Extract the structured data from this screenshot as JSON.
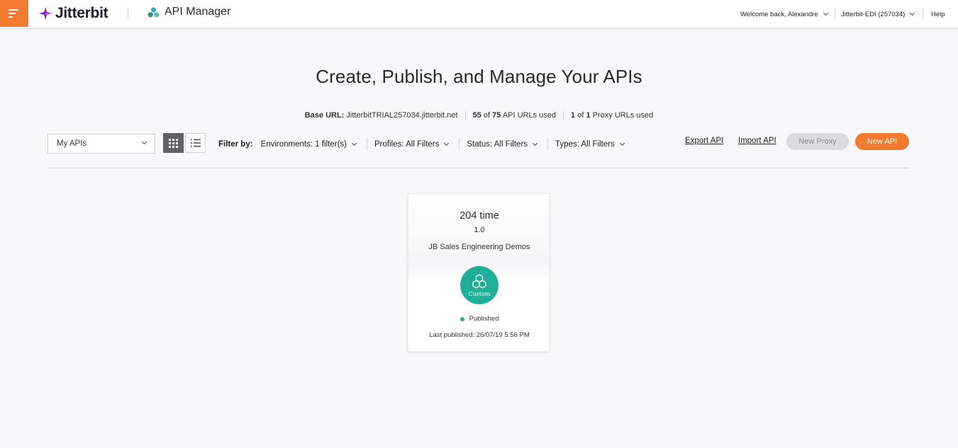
{
  "header": {
    "logo_text": "Jitterbit",
    "app_title": "API Manager",
    "welcome": "Welcome back, Alexandre",
    "org": "Jitterbit-EDI (257034)",
    "help": "Help"
  },
  "main": {
    "title": "Create, Publish, and Manage Your APIs",
    "stats": {
      "base_url_label": "Base URL:",
      "base_url": "JitterbitTRIAL257034.jitterbit.net",
      "api_used": "55",
      "api_of": "of",
      "api_total": "75",
      "api_suffix": "API URLs used",
      "proxy_used": "1",
      "proxy_of": "of",
      "proxy_total": "1",
      "proxy_suffix": "Proxy URLs used"
    },
    "api_select": "My APIs",
    "filter_label": "Filter by:",
    "filters": [
      "Environments: 1 filter(s)",
      "Profiles: All Filters",
      "Status: All Filters",
      "Types: All Filters"
    ],
    "export_api": "Export API",
    "import_api": "Import API",
    "new_proxy": "New Proxy",
    "new_api": "New API"
  },
  "cards": [
    {
      "name": "204 time",
      "version": "1.0",
      "environment": "JB Sales Engineering Demos",
      "type_badge": "Custom",
      "status": "Published",
      "last_published": "Last published: 26/07/19 5:56 PM"
    }
  ],
  "colors": {
    "accent": "#f27b2f",
    "badge": "#1fae98",
    "published": "#22b573"
  }
}
